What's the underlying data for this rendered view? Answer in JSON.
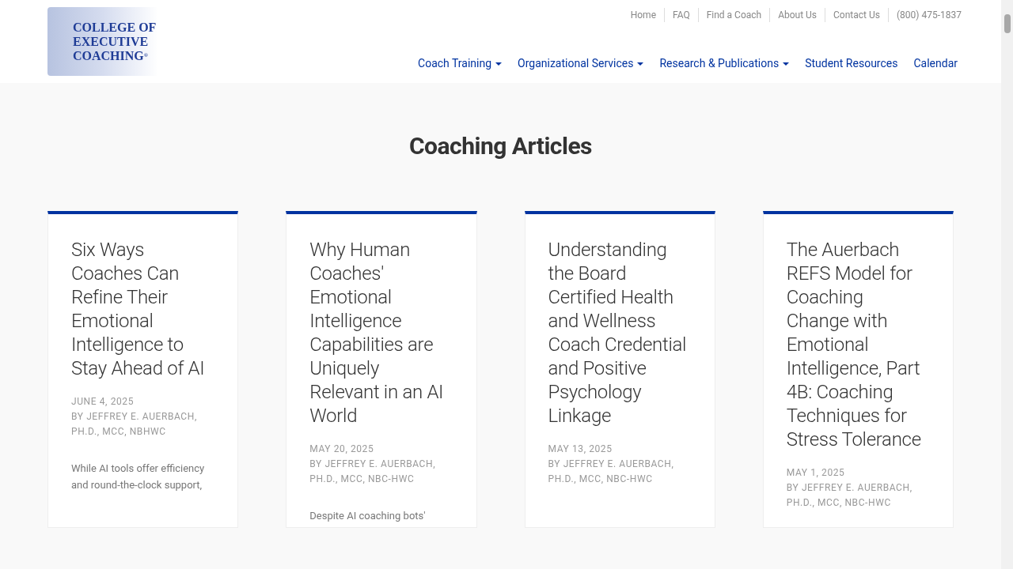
{
  "logo": {
    "lines": [
      "COLLEGE OF",
      "EXECUTIVE",
      "COACHING"
    ],
    "mark": "®"
  },
  "top_links": [
    "Home",
    "FAQ",
    "Find a Coach",
    "About Us",
    "Contact Us",
    "(800) 475-1837"
  ],
  "nav": [
    {
      "label": "Coach Training",
      "dropdown": true
    },
    {
      "label": "Organizational Services",
      "dropdown": true
    },
    {
      "label": "Research & Publications",
      "dropdown": true
    },
    {
      "label": "Student Resources",
      "dropdown": false
    },
    {
      "label": "Calendar",
      "dropdown": false
    }
  ],
  "heading": "Coaching Articles",
  "articles": [
    {
      "title": "Six Ways Coaches Can Refine Their Emotional Intelligence to Stay Ahead of AI",
      "date": "JUNE 4, 2025",
      "byline": "BY JEFFREY E. AUERBACH, PH.D., MCC, NBHWC",
      "excerpt": "While AI tools offer efficiency and round-the-clock support,"
    },
    {
      "title": "Why Human Coaches' Emotional Intelligence Capabilities are Uniquely Relevant in an AI World",
      "date": "MAY 20, 2025",
      "byline": "BY JEFFREY E. AUERBACH, PH.D., MCC, NBC-HWC",
      "excerpt": "Despite AI coaching bots'"
    },
    {
      "title": "Understanding the Board Certified Health and Wellness Coach Credential and Positive Psychology Linkage",
      "date": "MAY 13, 2025",
      "byline": "BY JEFFREY E. AUERBACH, PH.D., MCC, NBC-HWC"
    },
    {
      "title": "The Auerbach REFS Model for Coaching Change with Emotional Intelligence, Part 4B: Coaching Techniques for Stress Tolerance",
      "date": "MAY 1, 2025",
      "byline": "BY JEFFREY E. AUERBACH, PH.D., MCC, NBC-HWC"
    }
  ]
}
